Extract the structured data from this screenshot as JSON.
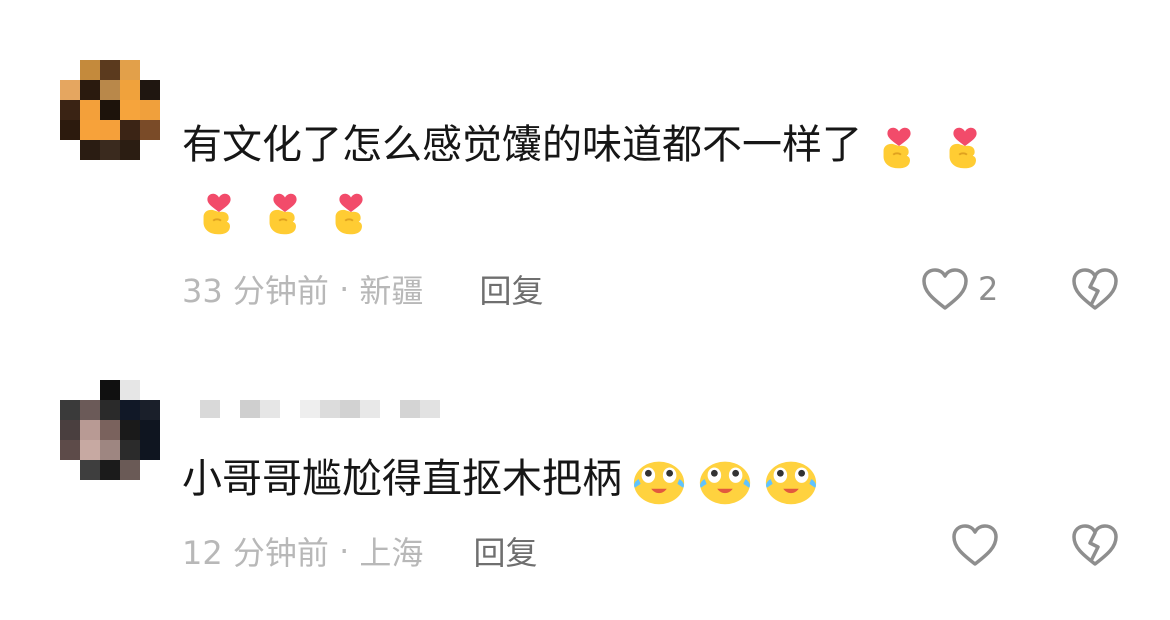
{
  "comments": [
    {
      "text": "有文化了怎么感觉馕的味道都不一样了",
      "emoji_icon": "finger-heart-icon",
      "emoji_count": 5,
      "time": "33 分钟前",
      "separator": "·",
      "location": "新疆",
      "reply_label": "回复",
      "like_count": "2"
    },
    {
      "text": "小哥哥尴尬得直抠木把柄",
      "emoji_icon": "crying-laughing-icon",
      "emoji_count": 3,
      "time": "12 分钟前",
      "separator": "·",
      "location": "上海",
      "reply_label": "回复",
      "like_count": ""
    }
  ],
  "colors": {
    "text": "#161616",
    "meta": "#b8b8b8",
    "reply": "#6f6f6f",
    "icon": "#8e8e8e"
  }
}
